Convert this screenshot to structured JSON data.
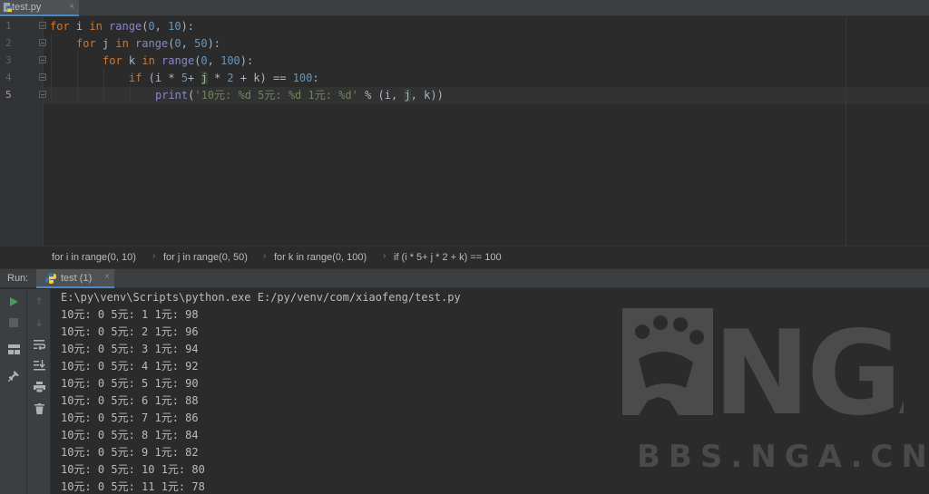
{
  "tab": {
    "filename": "test.py",
    "close": "×"
  },
  "editor": {
    "line_numbers": [
      "1",
      "2",
      "3",
      "4",
      "5"
    ],
    "lines": [
      {
        "kw1": "for",
        "v": " i ",
        "kw2": "in",
        "fn": " range",
        "rest_a": "(",
        "n1": "0",
        "sep": ", ",
        "n2": "10",
        "rest_b": "):"
      },
      {
        "kw1": "for",
        "v": " j ",
        "kw2": "in",
        "fn": " range",
        "rest_a": "(",
        "n1": "0",
        "sep": ", ",
        "n2": "50",
        "rest_b": "):"
      },
      {
        "kw1": "for",
        "v": " k ",
        "kw2": "in",
        "fn": " range",
        "rest_a": "(",
        "n1": "0",
        "sep": ", ",
        "n2": "100",
        "rest_b": "):"
      }
    ],
    "line4": {
      "kw": "if",
      "a": " (i * ",
      "n1": "5",
      "b": "+ ",
      "j": "j",
      "c": " * ",
      "n2": "2",
      "d": " + k) == ",
      "n3": "100",
      "e": ":"
    },
    "line5": {
      "fn": "print",
      "a": "(",
      "s": "'10元: %d 5元: %d 1元: %d'",
      "b": " % (i, ",
      "j": "j",
      "c": ", k))"
    }
  },
  "breadcrumb": [
    "for i in range(0, 10)",
    "for j in range(0, 50)",
    "for k in range(0, 100)",
    "if (i * 5+ j * 2 + k) == 100"
  ],
  "run": {
    "label": "Run:",
    "tab_label": "test (1)",
    "close": "×",
    "command": "E:\\py\\venv\\Scripts\\python.exe E:/py/venv/com/xiaofeng/test.py",
    "output": [
      "10元: 0 5元: 1 1元: 98",
      "10元: 0 5元: 2 1元: 96",
      "10元: 0 5元: 3 1元: 94",
      "10元: 0 5元: 4 1元: 92",
      "10元: 0 5元: 5 1元: 90",
      "10元: 0 5元: 6 1元: 88",
      "10元: 0 5元: 7 1元: 86",
      "10元: 0 5元: 8 1元: 84",
      "10元: 0 5元: 9 1元: 82",
      "10元: 0 5元: 10 1元: 80",
      "10元: 0 5元: 11 1元: 78"
    ]
  },
  "watermark": {
    "logo_text": "NGA",
    "url": "BBS.NGA.CN"
  },
  "colors": {
    "keyword": "#cc7832",
    "number": "#6897bb",
    "string": "#6a8759",
    "builtin": "#8888c6",
    "run_green": "#499c54"
  },
  "icons": [
    "python-file-icon",
    "run-icon",
    "stop-icon",
    "layout-icon",
    "pin-icon",
    "up-arrow-icon",
    "down-arrow-icon",
    "soft-wrap-icon",
    "scroll-to-end-icon",
    "print-icon",
    "trash-icon"
  ]
}
